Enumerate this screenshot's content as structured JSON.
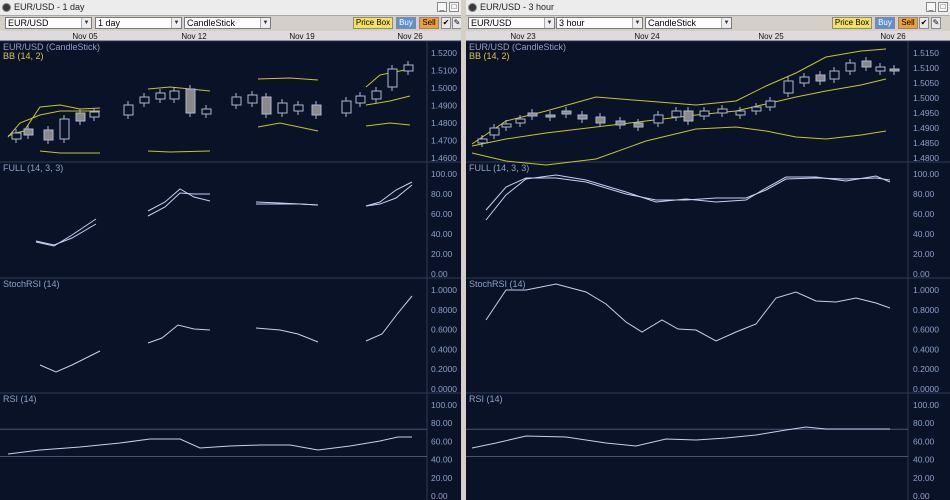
{
  "windows": [
    {
      "title": "EUR/USD - 1 day",
      "symbol": "EUR/USD",
      "period": "1 day",
      "chart_type": "CandleStick",
      "dates": [
        "Nov 05",
        "Nov 12",
        "Nov 19",
        "Nov 26"
      ],
      "buttons": {
        "price_box": "Price Box",
        "buy": "Buy",
        "sell": "Sell"
      },
      "panes": [
        {
          "label": "EUR/USD (CandleStick)",
          "sub": "BB (14, 2)",
          "ticks": [
            "1.5200",
            "1.5100",
            "1.5000",
            "1.4900",
            "1.4800",
            "1.4700",
            "1.4600"
          ]
        },
        {
          "label": "FULL (14, 3, 3)",
          "ticks": [
            "100.00",
            "80.00",
            "60.00",
            "40.00",
            "20.00",
            "0.00"
          ]
        },
        {
          "label": "StochRSI (14)",
          "ticks": [
            "1.0000",
            "0.8000",
            "0.6000",
            "0.4000",
            "0.2000",
            "0.0000"
          ]
        },
        {
          "label": "RSI (14)",
          "ticks": [
            "100.00",
            "80.00",
            "60.00",
            "40.00",
            "20.00",
            "0.00"
          ]
        }
      ]
    },
    {
      "title": "EUR/USD - 3 hour",
      "symbol": "EUR/USD",
      "period": "3 hour",
      "chart_type": "CandleStick",
      "dates": [
        "Nov 23",
        "Nov 24",
        "Nov 25",
        "Nov 26"
      ],
      "buttons": {
        "price_box": "Price Box",
        "buy": "Buy",
        "sell": "Sell"
      },
      "panes": [
        {
          "label": "EUR/USD (CandleStick)",
          "sub": "BB (14, 2)",
          "ticks": [
            "1.5150",
            "1.5100",
            "1.5050",
            "1.5000",
            "1.4950",
            "1.4900",
            "1.4850",
            "1.4800"
          ]
        },
        {
          "label": "FULL (14, 3, 3)",
          "ticks": [
            "100.00",
            "80.00",
            "60.00",
            "40.00",
            "20.00",
            "0.00"
          ]
        },
        {
          "label": "StochRSI (14)",
          "ticks": [
            "1.0000",
            "0.8000",
            "0.6000",
            "0.4000",
            "0.2000",
            "0.0000"
          ]
        },
        {
          "label": "RSI (14)",
          "ticks": [
            "100.00",
            "80.00",
            "60.00",
            "40.00",
            "20.00",
            "0.00"
          ]
        }
      ]
    }
  ],
  "colors": {
    "chart_bg": "#091226",
    "line": "#c8d0f0",
    "band": "#c8c820",
    "grid": "#2e3a55",
    "text": "#8fa0c8",
    "bull": "#0a1226",
    "bear": "#8a8a8a"
  }
}
